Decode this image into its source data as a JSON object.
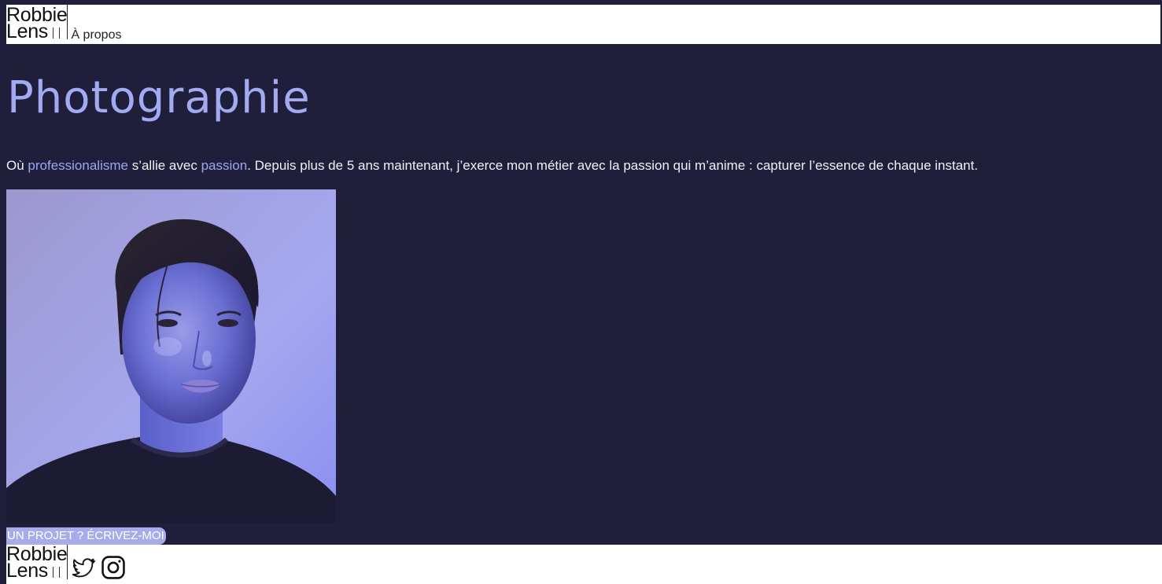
{
  "brand": {
    "line1": "Robbie",
    "line2": "Lens"
  },
  "nav": {
    "items": [
      {
        "label": "À propos"
      }
    ]
  },
  "hero": {
    "title": "Photographie",
    "intro": {
      "prefix": "Où ",
      "accent1": "professionalisme",
      "middle": " s’allie avec ",
      "accent2": "passion",
      "suffix": ". Depuis plus de 5 ans maintenant, j’exerce mon métier avec la passion qui m’anime : capturer l’essence de chaque instant."
    }
  },
  "cta": {
    "label": "UN PROJET ? ÉCRIVEZ-MOI"
  },
  "footer": {
    "social": [
      {
        "icon": "twitter-icon"
      },
      {
        "icon": "instagram-icon"
      }
    ]
  },
  "colors": {
    "background": "#1f1f3c",
    "accent": "#a3aaf2",
    "cta_bg": "#a7abea",
    "header_bg": "#ffffff"
  }
}
